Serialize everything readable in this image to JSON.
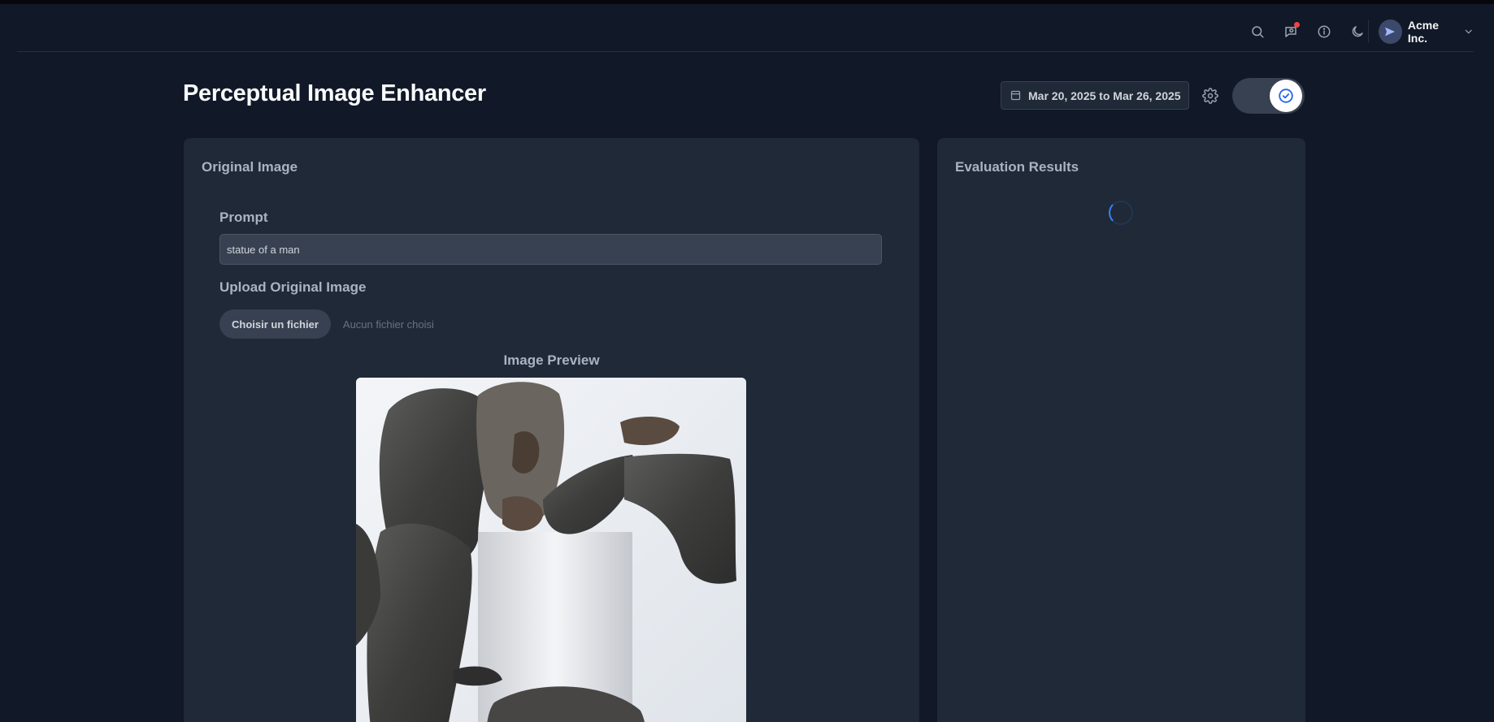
{
  "header": {
    "icons": [
      "search-icon",
      "messages-icon",
      "info-icon",
      "moon-icon"
    ],
    "user": {
      "name": "Acme Inc.",
      "avatar_icon": "send-icon"
    }
  },
  "page": {
    "title": "Perceptual Image Enhancer",
    "date_range": "Mar 20, 2025 to Mar 26, 2025"
  },
  "original_card": {
    "title": "Original Image",
    "prompt_label": "Prompt",
    "prompt_value": "statue of a man",
    "upload_label": "Upload Original Image",
    "file_button": "Choisir un fichier",
    "file_status": "Aucun fichier choisi",
    "preview_label": "Image Preview"
  },
  "eval_card": {
    "title": "Evaluation Results",
    "loading_icon": "spinner-icon"
  },
  "colors": {
    "background": "#111827",
    "card": "#1f2937",
    "accent": "#3b82f6",
    "notification": "#ef4444"
  }
}
